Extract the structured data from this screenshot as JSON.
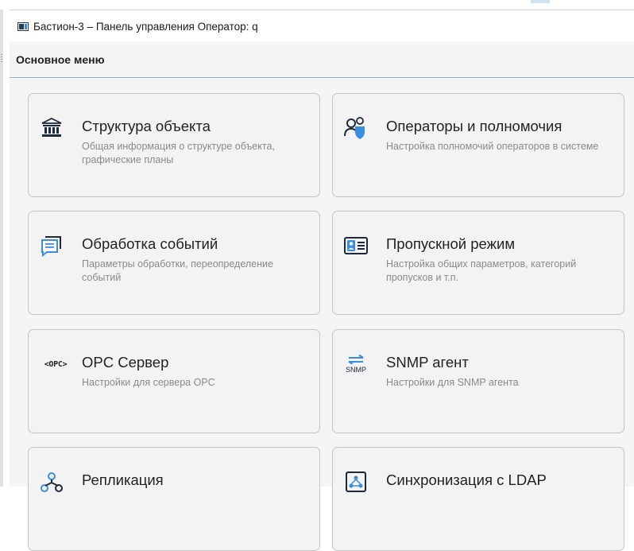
{
  "window": {
    "title": "Бастион-3 – Панель управления Оператор: q"
  },
  "menu": {
    "header": "Основное меню"
  },
  "cards": [
    {
      "title": "Структура объекта",
      "description": "Общая информация о структуре объекта, графические планы",
      "icon": "building-icon"
    },
    {
      "title": "Операторы и полномочия",
      "description": "Настройка полномочий операторов в системе",
      "icon": "operators-shield-icon"
    },
    {
      "title": "Обработка событий",
      "description": "Параметры обработки, переопределение событий",
      "icon": "chat-bubble-icon"
    },
    {
      "title": "Пропускной режим",
      "description": "Настройка общих параметров, категорий пропусков и т.п.",
      "icon": "id-card-icon"
    },
    {
      "title": "OPC Сервер",
      "description": "Настройки для сервера OPC",
      "icon": "opc-icon",
      "icon_text": "<OPC>"
    },
    {
      "title": "SNMP агент",
      "description": "Настройки для SNMP агента",
      "icon": "snmp-icon",
      "icon_text": "SNMP"
    },
    {
      "title": "Репликация",
      "description": "",
      "icon": "replication-icon"
    },
    {
      "title": "Синхронизация с LDAP",
      "description": "",
      "icon": "ldap-sync-icon"
    }
  ],
  "colors": {
    "accent_blue": "#3a8de0",
    "icon_dark": "#2a3b55",
    "card_border": "#c4c4c4",
    "description_text": "#8a8a8a"
  }
}
